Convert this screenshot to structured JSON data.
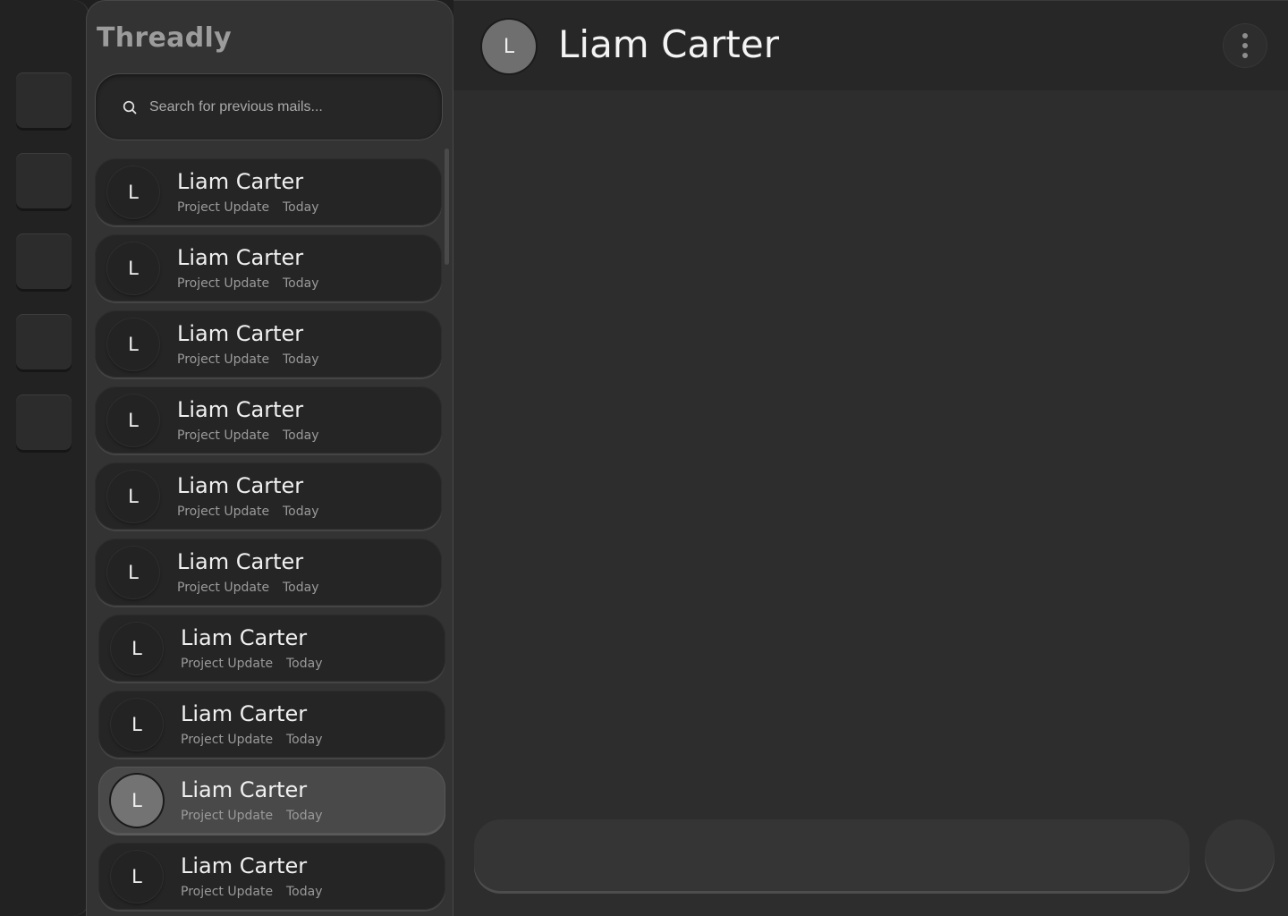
{
  "app": {
    "brand": "Threadly"
  },
  "search": {
    "placeholder": "Search for previous mails..."
  },
  "mail_list": [
    {
      "initial": "L",
      "name": "Liam Carter",
      "subject": "Project Update",
      "date": "Today",
      "active": false
    },
    {
      "initial": "L",
      "name": "Liam Carter",
      "subject": "Project Update",
      "date": "Today",
      "active": false
    },
    {
      "initial": "L",
      "name": "Liam Carter",
      "subject": "Project Update",
      "date": "Today",
      "active": false
    },
    {
      "initial": "L",
      "name": "Liam Carter",
      "subject": "Project Update",
      "date": "Today",
      "active": false
    },
    {
      "initial": "L",
      "name": "Liam Carter",
      "subject": "Project Update",
      "date": "Today",
      "active": false
    },
    {
      "initial": "L",
      "name": "Liam Carter",
      "subject": "Project Update",
      "date": "Today",
      "active": false
    },
    {
      "initial": "L",
      "name": "Liam Carter",
      "subject": "Project Update",
      "date": "Today",
      "active": false
    },
    {
      "initial": "L",
      "name": "Liam Carter",
      "subject": "Project Update",
      "date": "Today",
      "active": false
    },
    {
      "initial": "L",
      "name": "Liam Carter",
      "subject": "Project Update",
      "date": "Today",
      "active": true
    },
    {
      "initial": "L",
      "name": "Liam Carter",
      "subject": "Project Update",
      "date": "Today",
      "active": false
    }
  ],
  "conversation": {
    "initial": "L",
    "title": "Liam Carter",
    "menu_icon": "more-vertical-icon",
    "composer_value": ""
  },
  "icons": {
    "search": "search-icon",
    "menu": "more-vertical-icon"
  }
}
